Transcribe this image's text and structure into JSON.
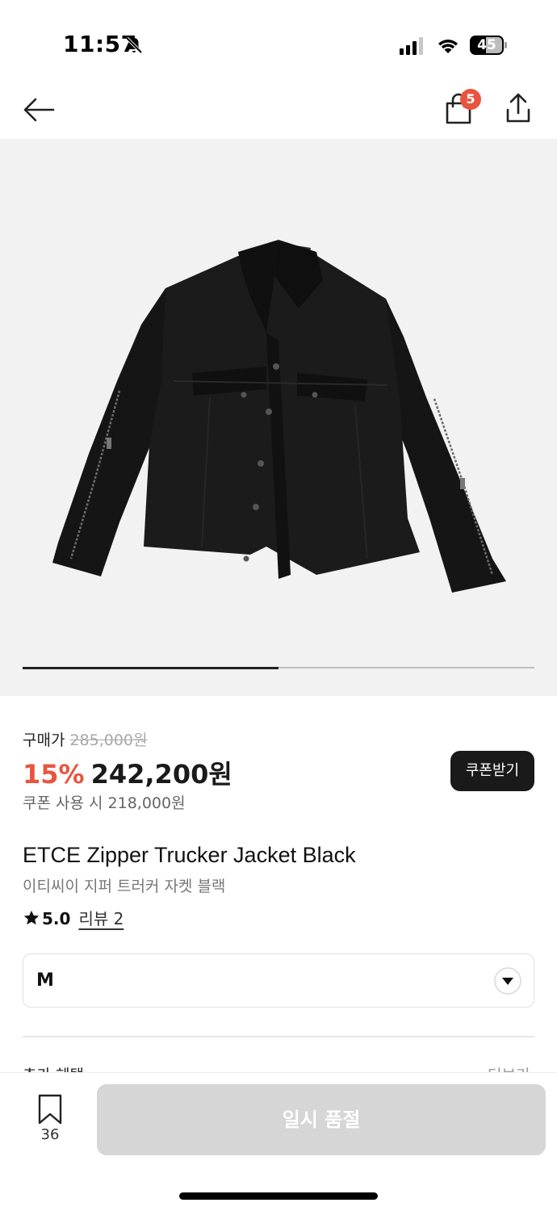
{
  "status_bar": {
    "time": "11:57",
    "battery": "45",
    "icons": [
      "bell-slash-icon",
      "cellular-signal-icon",
      "wifi-icon",
      "battery-icon"
    ]
  },
  "nav": {
    "cart_badge": "5",
    "icons": [
      "arrow-left-icon",
      "shopping-bag-icon",
      "share-icon"
    ]
  },
  "carousel": {
    "progress": 0.5
  },
  "price": {
    "label": "구매가",
    "original": "285,000원",
    "discount": "15%",
    "sale": "242,200원",
    "coupon_price": "쿠폰 사용 시 218,000원",
    "coupon_button": "쿠폰받기"
  },
  "product": {
    "name_en": "ETCE Zipper Trucker Jacket Black",
    "name_ko": "이티씨이 지퍼 트러커 자켓 블랙",
    "rating": "5.0",
    "review_link": "리뷰 2"
  },
  "option": {
    "selected": "M"
  },
  "section_cut": {
    "left": "추가 혜택",
    "right": "더보기"
  },
  "bottom": {
    "bookmark_count": "36",
    "soldout_label": "일시 품절"
  },
  "colors": {
    "accent": "#e8553f",
    "dark_button": "#1a1a1a",
    "disabled_button": "#d6d6d6"
  }
}
